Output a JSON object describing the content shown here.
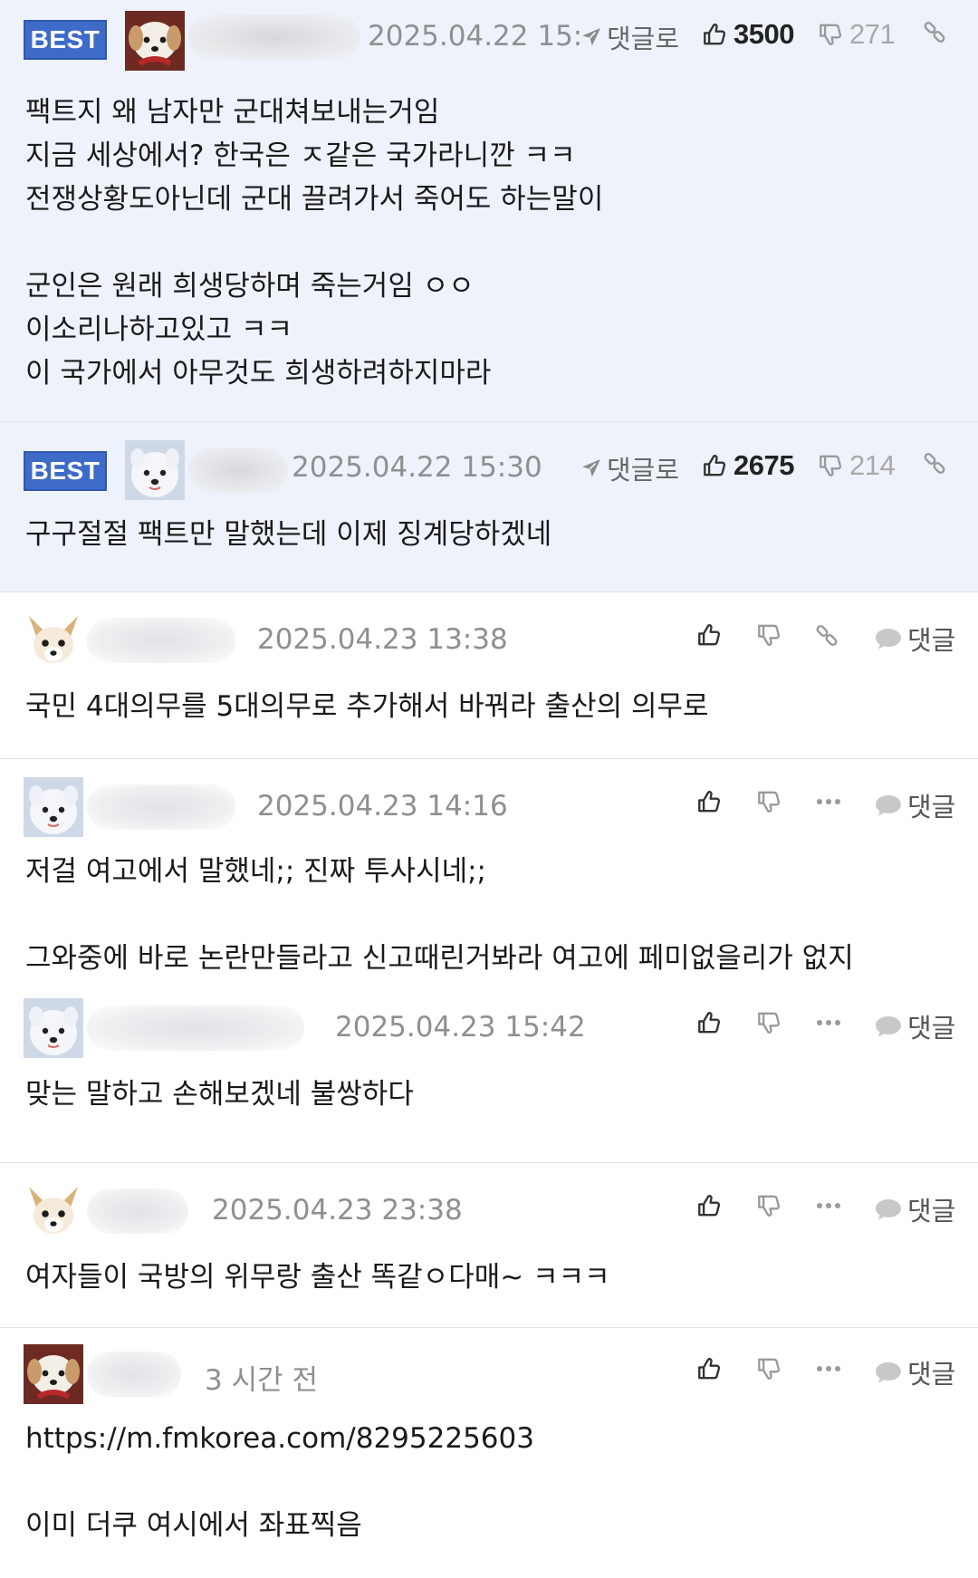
{
  "comments": [
    {
      "best": true,
      "badge": "BEST",
      "date": "2025.04.22 15:",
      "reply_label": "댓글로",
      "likes": "3500",
      "dislikes": "271",
      "text": "팩트지 왜 남자만 군대쳐보내는거임\n지금 세상에서? 한국은 ㅈ같은 국가라니깐 ㅋㅋ\n전쟁상황도아닌데 군대 끌려가서 죽어도 하는말이\n\n군인은 원래 희생당하며 죽는거임 ㅇㅇ\n이소리나하고있고 ㅋㅋ\n이 국가에서 아무것도 희생하려하지마라"
    },
    {
      "best": true,
      "badge": "BEST",
      "date": "2025.04.22 15:30",
      "reply_label": "댓글로",
      "likes": "2675",
      "dislikes": "214",
      "text": "구구절절 팩트만 말했는데 이제 징계당하겠네"
    },
    {
      "date": "2025.04.23 13:38",
      "reply_label": "댓글",
      "text": "국민 4대의무를 5대의무로 추가해서 바꿔라 출산의 의무로"
    },
    {
      "date": "2025.04.23 14:16",
      "reply_label": "댓글",
      "text": "저걸 여고에서 말했네;; 진짜 투사시네;;\n\n그와중에 바로 논란만들라고 신고때린거봐라 여고에 페미없을리가 없지"
    },
    {
      "date": "2025.04.23 15:42",
      "reply_label": "댓글",
      "text": "맞는 말하고 손해보겠네 불쌍하다"
    },
    {
      "date": "2025.04.23 23:38",
      "reply_label": "댓글",
      "text": "여자들이 국방의 위무랑 출산 똑같ㅇ다매~ ㅋㅋㅋ"
    },
    {
      "date": "3 시간 전",
      "reply_label": "댓글",
      "text": "https://m.fmkorea.com/8295225603\n\n이미 더쿠 여시에서 좌표찍음"
    }
  ]
}
